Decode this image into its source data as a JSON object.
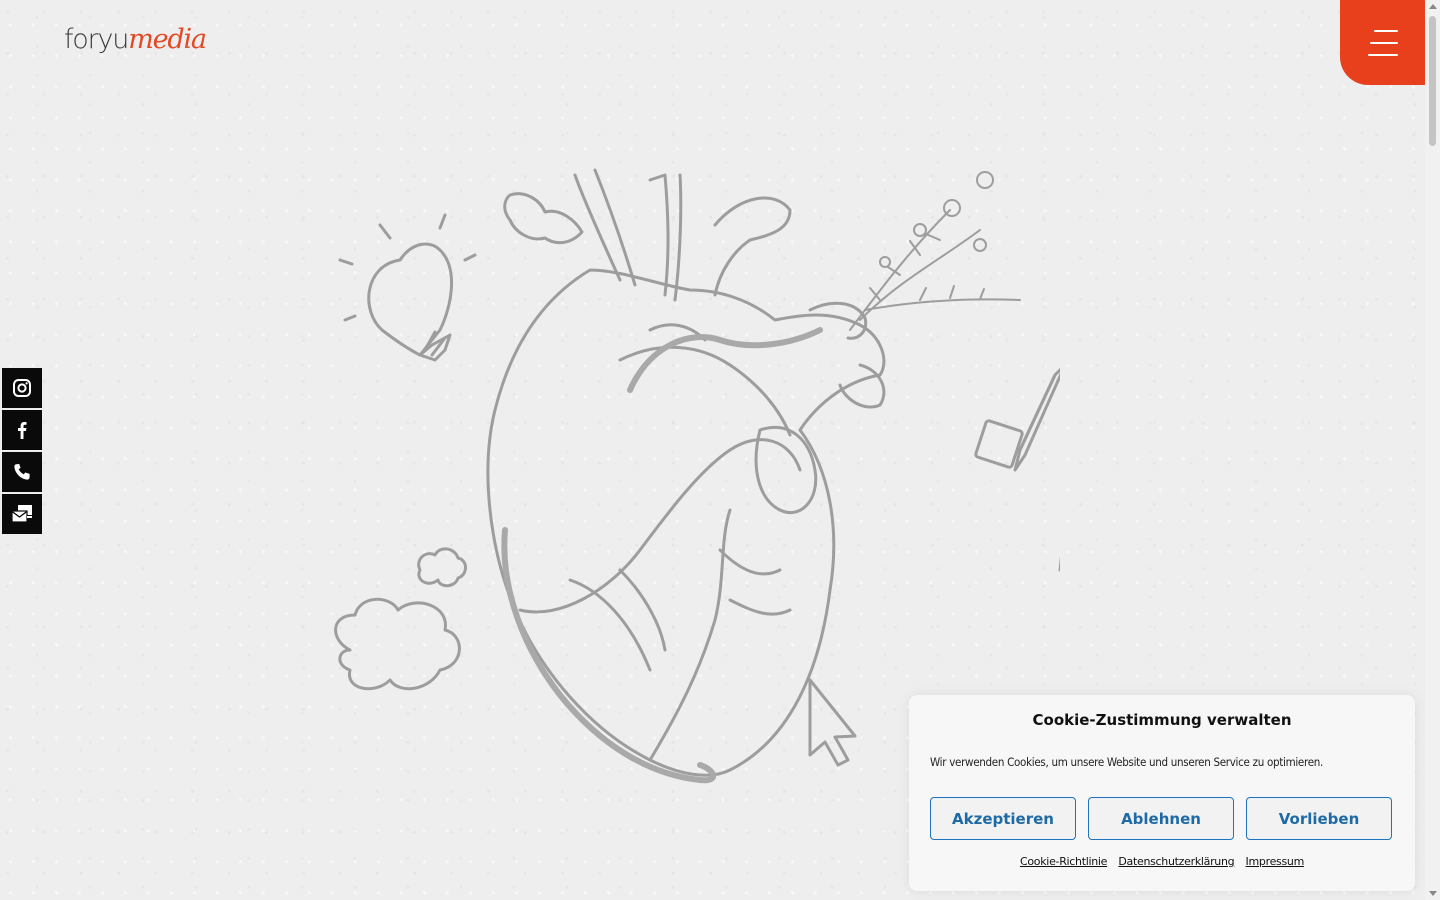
{
  "header": {
    "logo_part1": "foryu",
    "logo_part2": "media",
    "menu_icon": "hamburger-menu-icon"
  },
  "social": [
    {
      "name": "instagram",
      "icon": "instagram-icon"
    },
    {
      "name": "facebook",
      "icon": "facebook-icon"
    },
    {
      "name": "phone",
      "icon": "phone-icon"
    },
    {
      "name": "mail",
      "icon": "mail-icon"
    }
  ],
  "cookie": {
    "title": "Cookie-Zustimmung verwalten",
    "text": "Wir verwenden Cookies, um unsere Website und unseren Service zu optimieren.",
    "accept_label": "Akzeptieren",
    "decline_label": "Ablehnen",
    "preferences_label": "Vorlieben",
    "links": {
      "cookie_policy": "Cookie-Richtlinie",
      "privacy": "Datenschutzerklärung",
      "imprint": "Impressum"
    }
  },
  "colors": {
    "accent": "#e8401c",
    "button_text": "#1e6aa6",
    "background": "#eeeeee"
  }
}
